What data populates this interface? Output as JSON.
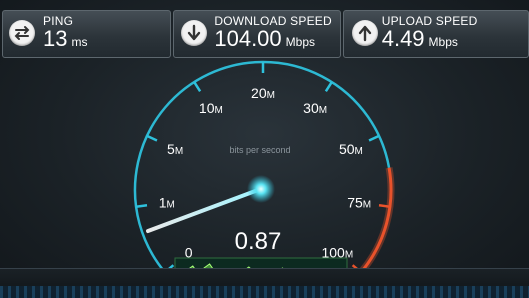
{
  "header": {
    "ping": {
      "label": "PING",
      "value": "13",
      "unit": "ms",
      "icon": "transfer-arrows-icon"
    },
    "download": {
      "label": "DOWNLOAD SPEED",
      "value": "104.00",
      "unit": "Mbps",
      "icon": "down-arrow-icon"
    },
    "upload": {
      "label": "UPLOAD SPEED",
      "value": "4.49",
      "unit": "Mbps",
      "icon": "up-arrow-icon"
    }
  },
  "gauge": {
    "caption": "bits per second",
    "current_value": "0.87",
    "scale": {
      "t0": "0",
      "t1": "1",
      "t5": "5",
      "t10": "10",
      "t20": "20",
      "t30": "30",
      "t50": "50",
      "t75": "75",
      "t100": "100"
    },
    "scale_suffix": "M",
    "needle_value_fraction": 0.37,
    "colors": {
      "arc": "#2ec1dc",
      "high_arc": "#e8522b",
      "graph": "#6edc4a"
    }
  }
}
